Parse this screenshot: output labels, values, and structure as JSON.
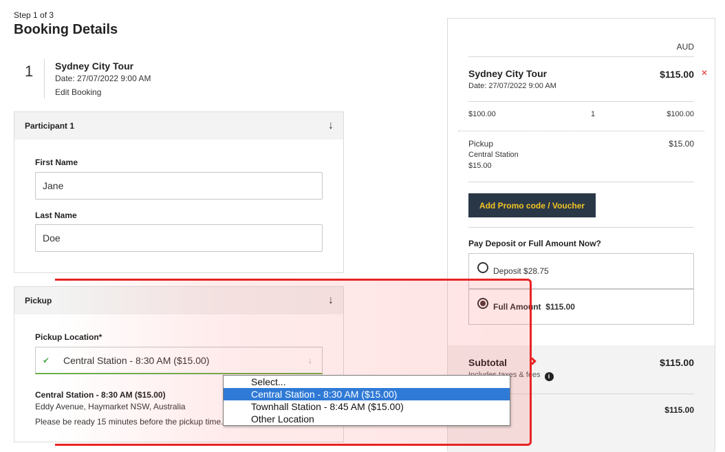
{
  "header": {
    "step": "Step 1 of 3",
    "title": "Booking Details"
  },
  "booking": {
    "number": "1",
    "title": "Sydney City Tour",
    "date": "Date: 27/07/2022   9:00 AM",
    "edit_label": "Edit Booking"
  },
  "participant": {
    "heading": "Participant  1",
    "first_name_label": "First Name",
    "first_name_value": "Jane",
    "last_name_label": "Last Name",
    "last_name_value": "Doe"
  },
  "pickup": {
    "heading": "Pickup",
    "location_label": "Pickup Location*",
    "location_value": "Central Station - 8:30 AM ($15.00)",
    "detail_title": "Central Station - 8:30 AM ($15.00)",
    "detail_address": "Eddy Avenue, Haymarket NSW, Australia",
    "detail_note": "Please be ready 15 minutes before the pickup time.",
    "options": [
      {
        "label": "Select..."
      },
      {
        "label": "Central Station - 8:30 AM ($15.00)",
        "selected": true
      },
      {
        "label": "Townhall Station - 8:45 AM ($15.00)"
      },
      {
        "label": "Other Location"
      }
    ]
  },
  "summary": {
    "currency": "AUD",
    "tour_title": "Sydney City Tour",
    "tour_date": "Date: 27/07/2022   9:00 AM",
    "tour_price": "$115.00",
    "line_unit_price": "$100.00",
    "line_qty": "1",
    "line_total": "$100.00",
    "pickup_label": "Pickup",
    "pickup_location": "Central Station",
    "pickup_subprice": "$15.00",
    "pickup_price": "$15.00",
    "promo_label": "Add Promo code / Voucher",
    "pay_question": "Pay Deposit or Full Amount Now?",
    "deposit_label": "Deposit $28.75",
    "full_label": "Full Amount",
    "full_amount": "$115.00",
    "subtotal_label": "Subtotal",
    "subtotal_value": "$115.00",
    "subtotal_note": "Includes taxes & fees",
    "total_value": "$115.00"
  },
  "icons": {
    "remove": "close-icon",
    "collapse": "arrow-down-icon",
    "valid": "check-icon",
    "info": "info-icon"
  },
  "colors": {
    "promo_bg": "#2a3747",
    "promo_text": "#f3c623",
    "remove": "#e53935",
    "valid": "#4ca64c",
    "dropdown_selected": "#2f7ad6",
    "highlight": "#e82323"
  }
}
